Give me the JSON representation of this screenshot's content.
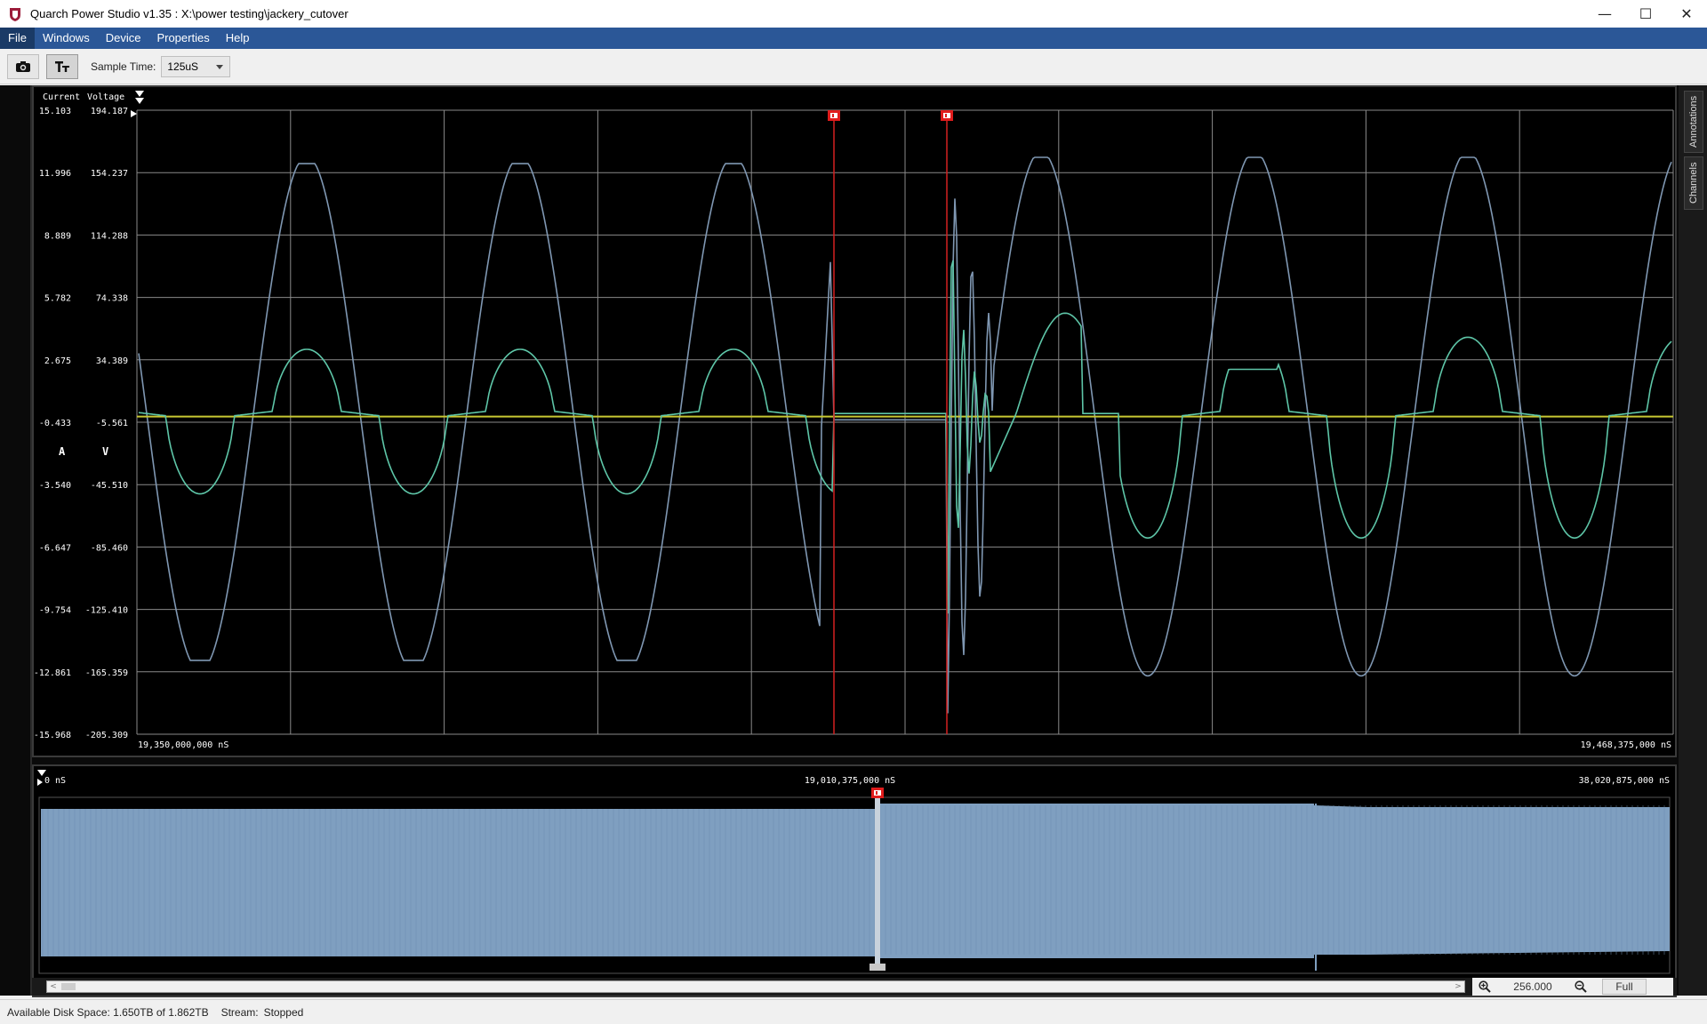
{
  "window": {
    "title": "Quarch Power Studio v1.35 : X:\\power testing\\jackery_cutover",
    "minimize": "—",
    "maximize": "☐",
    "close": "✕"
  },
  "menu": {
    "items": [
      "File",
      "Windows",
      "Device",
      "Properties",
      "Help"
    ]
  },
  "toolbar": {
    "sample_time_label": "Sample Time:",
    "sample_time_value": "125uS"
  },
  "plot": {
    "current_header": "Current",
    "voltage_header": "Voltage",
    "current_unit": "A",
    "voltage_unit": "V",
    "current_ticks": [
      "15.103",
      "11.996",
      "8.889",
      "5.782",
      "2.675",
      "-0.433",
      "-3.540",
      "-6.647",
      "-9.754",
      "-12.861",
      "-15.968"
    ],
    "voltage_ticks": [
      "194.187",
      "154.237",
      "114.288",
      "74.338",
      "34.389",
      "-5.561",
      "-45.510",
      "-85.460",
      "-125.410",
      "-165.359",
      "-205.309"
    ],
    "x_start": "19,350,000,000 nS",
    "x_end": "19,468,375,000 nS",
    "colors": {
      "voltage": "#7f97b2",
      "current": "#5ec6a8",
      "zero": "#c8c832",
      "marker": "#d42020",
      "grid": "#8a8a8a"
    }
  },
  "overview": {
    "start_label": "0 nS",
    "mid_label": "19,010,375,000 nS",
    "end_label": "38,020,875,000 nS",
    "fill_color": "#7f9fc0"
  },
  "zoom": {
    "value": "256.000",
    "full_label": "Full"
  },
  "side_tabs": {
    "annotations": "Annotations",
    "channels": "Channels"
  },
  "status": {
    "disk": "Available Disk Space: 1.650TB of 1.862TB",
    "stream_label": "Stream:",
    "stream_value": "Stopped"
  }
}
